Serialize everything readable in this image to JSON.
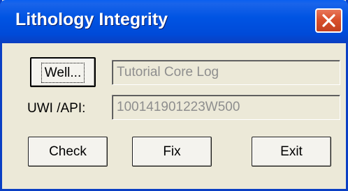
{
  "window": {
    "title": "Lithology Integrity",
    "close_icon": "close-icon"
  },
  "well": {
    "button_label": "Well...",
    "value": "Tutorial Core Log"
  },
  "uwi": {
    "label": "UWI /API:",
    "value": "100141901223W500"
  },
  "actions": {
    "check_label": "Check",
    "fix_label": "Fix",
    "exit_label": "Exit"
  },
  "colors": {
    "titlebar": "#0054e3",
    "close_button": "#d9502c",
    "dialog_background": "#ece9d8",
    "disabled_text": "#8e8e8e"
  }
}
